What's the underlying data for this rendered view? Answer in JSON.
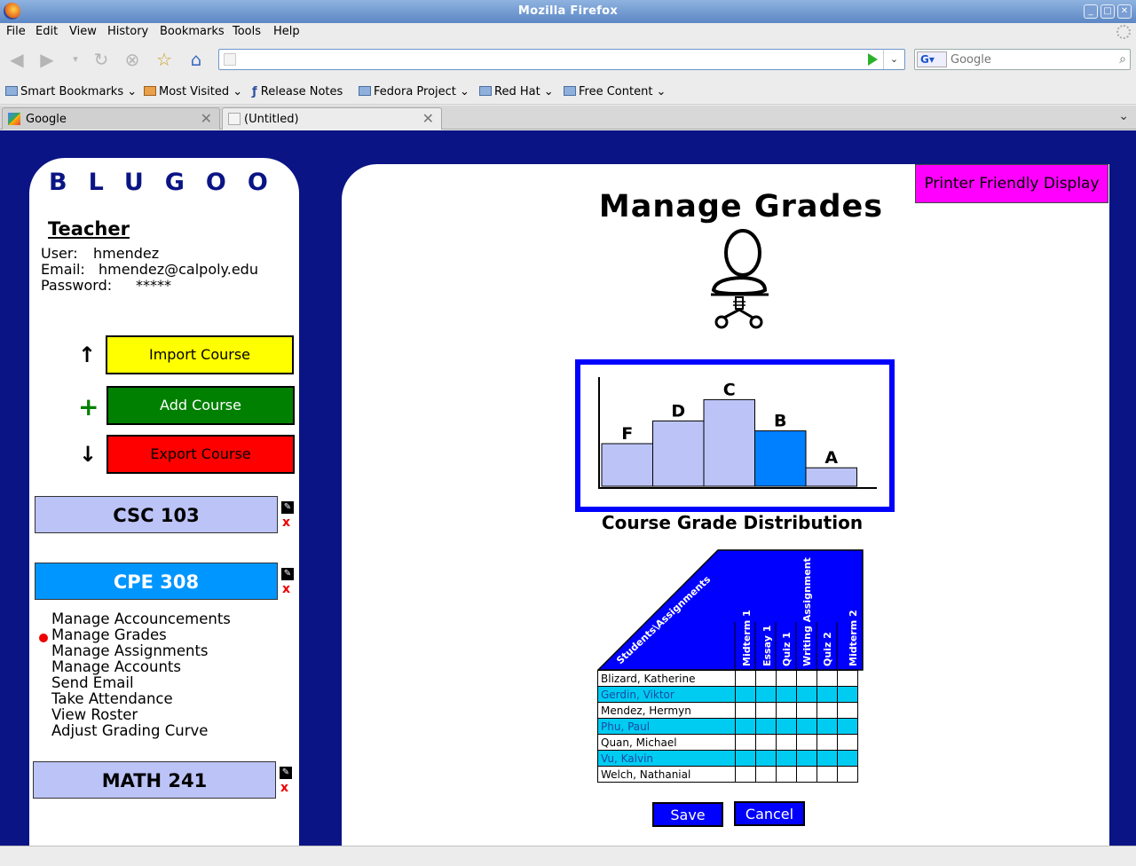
{
  "window": {
    "title": "Mozilla Firefox"
  },
  "menu": [
    "File",
    "Edit",
    "View",
    "History",
    "Bookmarks",
    "Tools",
    "Help"
  ],
  "urlbar": {
    "value": ""
  },
  "search": {
    "engine": "G",
    "placeholder": "Google"
  },
  "bookmarks": [
    "Smart Bookmarks",
    "Most Visited",
    "Release Notes",
    "Fedora Project",
    "Red Hat",
    "Free Content"
  ],
  "tabs": [
    {
      "label": "Google"
    },
    {
      "label": "(Untitled)"
    }
  ],
  "sidebar": {
    "logo": "BLUGOO",
    "role_heading": "Teacher",
    "user_label": "User:",
    "user": "hmendez",
    "email_label": "Email:",
    "email": "hmendez@calpoly.edu",
    "password_label": "Password:",
    "password": "*****",
    "actions": [
      {
        "label": "Import Course",
        "icon": "↑",
        "color": "#ffff00",
        "text_color": "#000000"
      },
      {
        "label": "Add Course",
        "icon": "+",
        "color": "#008000",
        "text_color": "#ffffff"
      },
      {
        "label": "Export Course",
        "icon": "↓",
        "color": "#ff0000",
        "text_color": "#000000"
      }
    ],
    "courses": [
      {
        "name": "CSC 103",
        "color": "#bcc3f7",
        "text_color": "#000000"
      },
      {
        "name": "CPE 308",
        "color": "#0096ff",
        "text_color": "#ffffff"
      },
      {
        "name": "MATH 241",
        "color": "#bcc3f7",
        "text_color": "#000000"
      }
    ],
    "course_menu": [
      "Manage Accouncements",
      "Manage Grades",
      "Manage Assignments",
      "Manage Accounts",
      "Send Email",
      "Take Attendance",
      "View Roster",
      "Adjust Grading Curve"
    ],
    "selected_menu_item": "Manage Grades"
  },
  "main": {
    "printer_button": "Printer Friendly Display",
    "title": "Manage Grades",
    "chart_caption": "Course Grade Distribution",
    "table_header": "Students\\Assignments",
    "assignments": [
      "Midterm 1",
      "Essay 1",
      "Quiz 1",
      "Writing Assignment",
      "Quiz 2",
      "Midterm 2"
    ],
    "students": [
      "Blizard, Katherine",
      "Gerdin, Viktor",
      "Mendez, Hermyn",
      "Phu, Paul",
      "Quan, Michael",
      "Vu, Kalvin",
      "Welch, Nathanial"
    ],
    "save": "Save",
    "cancel": "Cancel"
  },
  "chart_data": {
    "type": "bar",
    "categories": [
      "F",
      "D",
      "C",
      "B",
      "A"
    ],
    "values": [
      3,
      4.6,
      6.1,
      3.9,
      1.3
    ],
    "highlight": "B",
    "bar_color": "#bcc3f7",
    "highlight_color": "#0080ff",
    "title": "Course Grade Distribution",
    "xlabel": "",
    "ylabel": ""
  },
  "colors": {
    "page_bg": "#0b1485",
    "accent": "#0000ff",
    "highlight_row": "#00ccf2"
  }
}
